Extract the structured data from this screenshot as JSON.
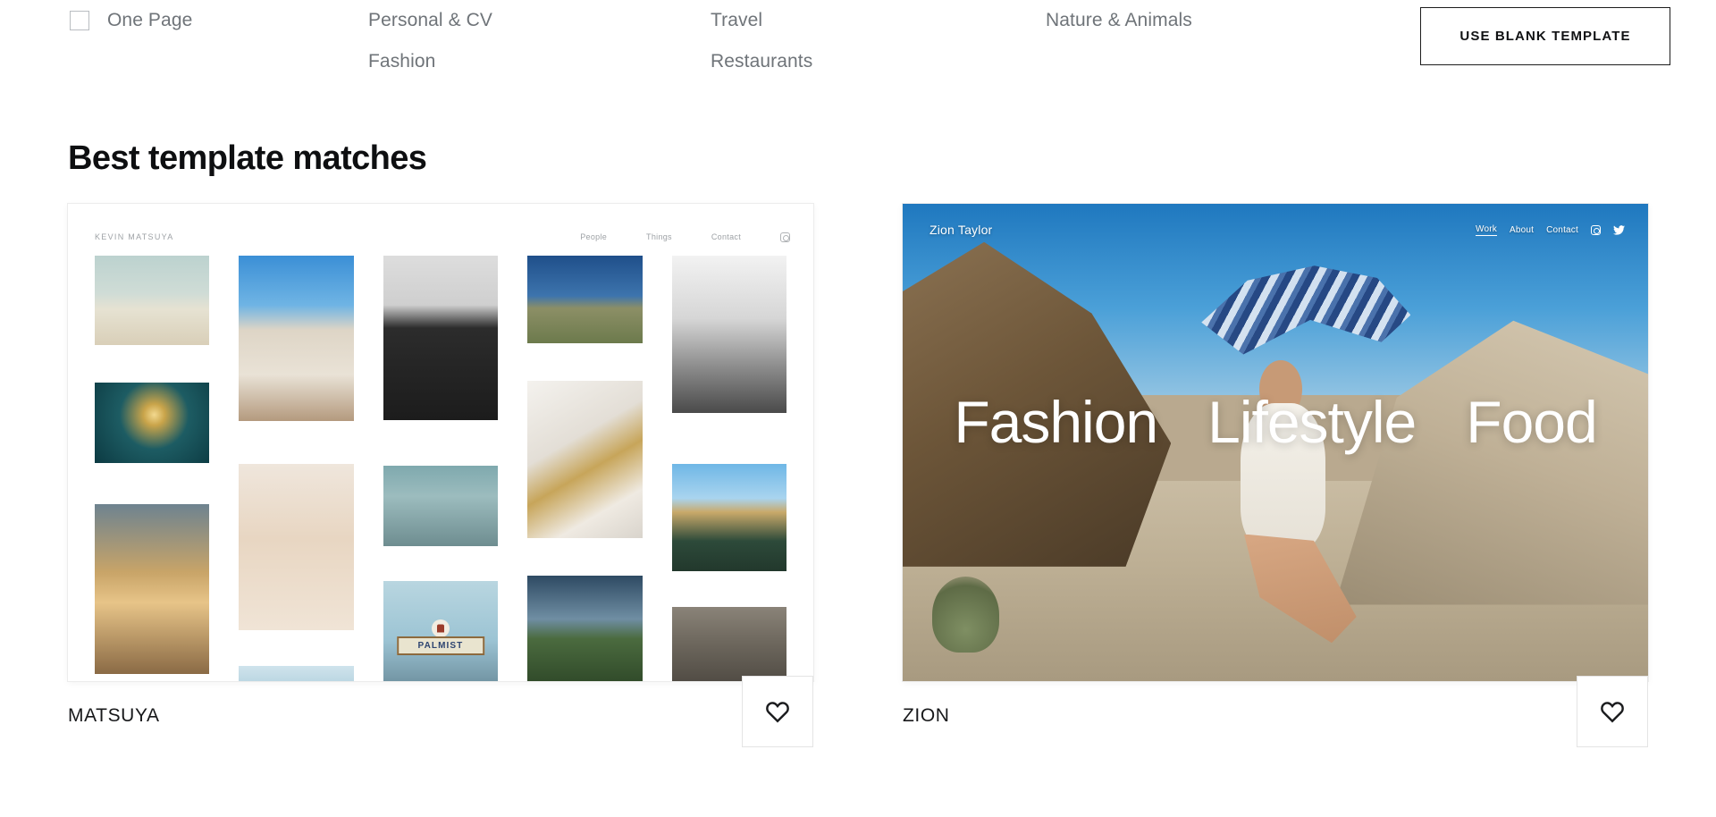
{
  "filters": {
    "columns": [
      {
        "items": [
          {
            "label": "One Page",
            "has_checkbox": true
          }
        ]
      },
      {
        "items": [
          {
            "label": "Personal & CV"
          },
          {
            "label": "Fashion"
          }
        ]
      },
      {
        "items": [
          {
            "label": "Travel"
          },
          {
            "label": "Restaurants"
          }
        ]
      },
      {
        "items": [
          {
            "label": "Nature & Animals"
          }
        ]
      }
    ],
    "blank_template_button": "USE BLANK TEMPLATE"
  },
  "section": {
    "heading": "Best template matches"
  },
  "cards": [
    {
      "name": "MATSUYA",
      "favorite_icon": "heart-icon",
      "preview": {
        "logo": "KEVIN MATSUYA",
        "nav": [
          "People",
          "Things",
          "Contact"
        ],
        "social_icon": "instagram-icon",
        "sign_text": "PALMIST"
      }
    },
    {
      "name": "ZION",
      "favorite_icon": "heart-icon",
      "preview": {
        "logo": "Zion Taylor",
        "nav": [
          "Work",
          "About",
          "Contact"
        ],
        "social_icons": [
          "instagram-icon",
          "twitter-icon"
        ],
        "hero_words": [
          "Fashion",
          "Lifestyle",
          "Food"
        ]
      }
    }
  ],
  "colors": {
    "text_primary": "#17181a",
    "text_muted": "#6f7479",
    "border": "#e4e4e4",
    "button_border": "#1d1d1d"
  }
}
